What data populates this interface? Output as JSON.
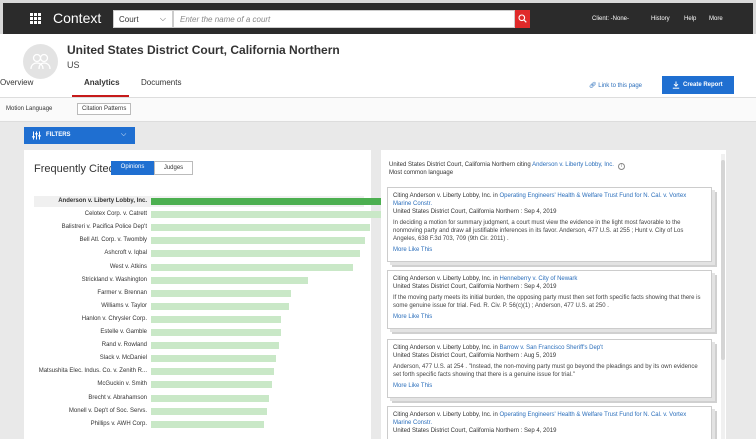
{
  "topbar": {
    "brand": "Context",
    "court_select": "Court",
    "search_placeholder": "Enter the name of a court",
    "client": "Client: -None-",
    "history": "History",
    "help": "Help",
    "more": "More"
  },
  "header": {
    "title": "United States District Court, California Northern",
    "subtitle": "US"
  },
  "tabs": [
    "Overview",
    "Analytics",
    "Documents"
  ],
  "actions": {
    "link_to_page": "Link to this page",
    "create_report": "Create Report"
  },
  "subtabs": [
    "Motion Language",
    "Citation Patterns"
  ],
  "filters": {
    "label": "FILTERS"
  },
  "left": {
    "title": "Frequently Cited",
    "toggle_opinions": "Opinions",
    "toggle_judges": "Judges"
  },
  "chart_data": {
    "type": "bar",
    "orientation": "horizontal",
    "categories": [
      "Anderson v. Liberty Lobby, Inc.",
      "Celotex Corp. v. Catrett",
      "Balistreri v. Pacifica Police Dep't",
      "Bell Atl. Corp. v. Twombly",
      "Ashcroft v. Iqbal",
      "West v. Atkins",
      "Strickland v. Washington",
      "Farmer v. Brennan",
      "Williams v. Taylor",
      "Hanlon v. Chrysler Corp.",
      "Estelle v. Gamble",
      "Rand v. Rowland",
      "Slack v. McDaniel",
      "Matsushita Elec. Indus. Co. v. Zenith R...",
      "McGuckin v. Smith",
      "Brecht v. Abrahamson",
      "Monell v. Dep't of Soc. Servs.",
      "Phillips v. AWH Corp."
    ],
    "values": [
      100,
      100,
      89,
      87,
      85,
      82,
      64,
      57,
      56,
      53,
      53,
      52,
      51,
      50,
      49,
      48,
      47,
      46
    ],
    "xlim": [
      0,
      100
    ],
    "highlighted": "Anderson v. Liberty Lobby, Inc.",
    "colors": {
      "highlight": "#4caf50",
      "default": "#c9e8c7"
    }
  },
  "right": {
    "head_prefix": "United States District Court, California Northern citing ",
    "head_link": "Anderson v. Liberty Lobby, Inc.",
    "head_sub": "Most common language",
    "cards": [
      {
        "citing": "Citing Anderson v. Liberty Lobby, Inc. in ",
        "case_link": "Operating Engineers' Health & Welfare Trust Fund for N. Cal. v. Vortex Marine Constr.",
        "court_date": "United States District Court, California Northern : Sep 4, 2019",
        "quote": "In deciding a motion for summary judgment, a court must view the evidence in the light most favorable to the nonmoving party and draw all justifiable inferences in its favor. Anderson, 477 U.S. at 255 ; Hunt v. City of Los Angeles, 638 F.3d 703, 709 (9th Cir. 2011) .",
        "more": "More Like This"
      },
      {
        "citing": "Citing Anderson v. Liberty Lobby, Inc. in ",
        "case_link": "Henneberry v. City of Newark",
        "court_date": "United States District Court, California Northern : Sep 4, 2019",
        "quote": "If the moving party meets its initial burden, the opposing party must then set forth specific facts showing that there is some genuine issue for trial. Fed. R. Civ. P. 56(c)(1) ; Anderson, 477 U.S. at 250 .",
        "more": "More Like This"
      },
      {
        "citing": "Citing Anderson v. Liberty Lobby, Inc. in ",
        "case_link": "Barrow v. San Francisco Sheriff's Dep't",
        "court_date": "United States District Court, California Northern : Aug 5, 2019",
        "quote": "Anderson, 477 U.S. at 254 . \"Instead, the non-moving party must go beyond the pleadings and by its own evidence set forth specific facts showing that there is a genuine issue for trial.\"",
        "more": "More Like This"
      },
      {
        "citing": "Citing Anderson v. Liberty Lobby, Inc. in ",
        "case_link": "Operating Engineers' Health & Welfare Trust Fund for N. Cal. v. Vortex Marine Constr.",
        "court_date": "United States District Court, California Northern : Sep 4, 2019",
        "quote": "",
        "more": ""
      }
    ]
  }
}
